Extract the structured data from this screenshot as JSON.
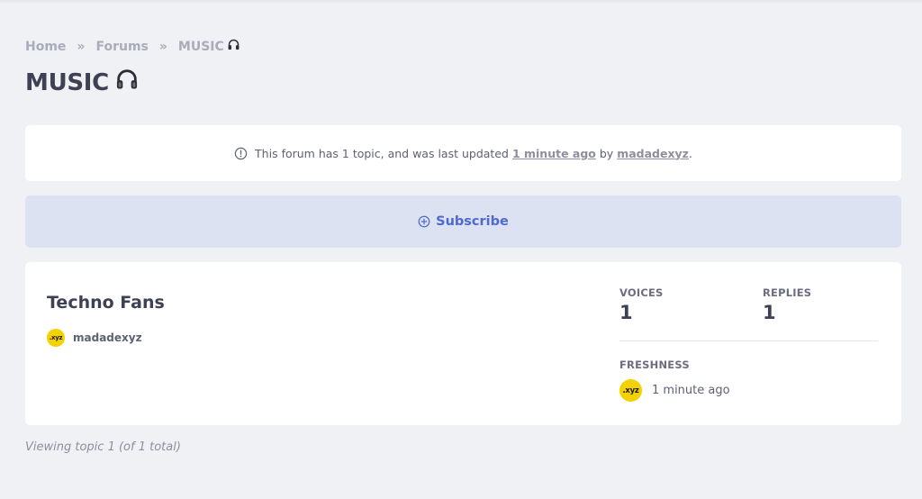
{
  "breadcrumb": {
    "home": "Home",
    "separator": "»",
    "forums": "Forums",
    "current": "MUSIC"
  },
  "page": {
    "title": "MUSIC",
    "title_icon": "headphones-icon"
  },
  "info": {
    "prefix": "This forum has 1 topic, and was last updated",
    "updated_link": "1 minute ago",
    "by": "by",
    "user_link": "madadexyz",
    "suffix": "."
  },
  "subscribe": {
    "label": "Subscribe",
    "icon": "plus-circle-icon"
  },
  "topic": {
    "title": "Techno Fans",
    "author": "madadexyz",
    "avatar_text": ".xyz",
    "avatar_color": "#f4d100",
    "voices_label": "VOICES",
    "voices": "1",
    "replies_label": "REPLIES",
    "replies": "1",
    "freshness_label": "FRESHNESS",
    "freshness": "1 minute ago"
  },
  "footer": {
    "viewing": "Viewing topic 1 (of 1 total)"
  },
  "colors": {
    "background": "#f0f1f4",
    "accent": "#5069cf",
    "subscribe_bg": "#dce2f1"
  }
}
